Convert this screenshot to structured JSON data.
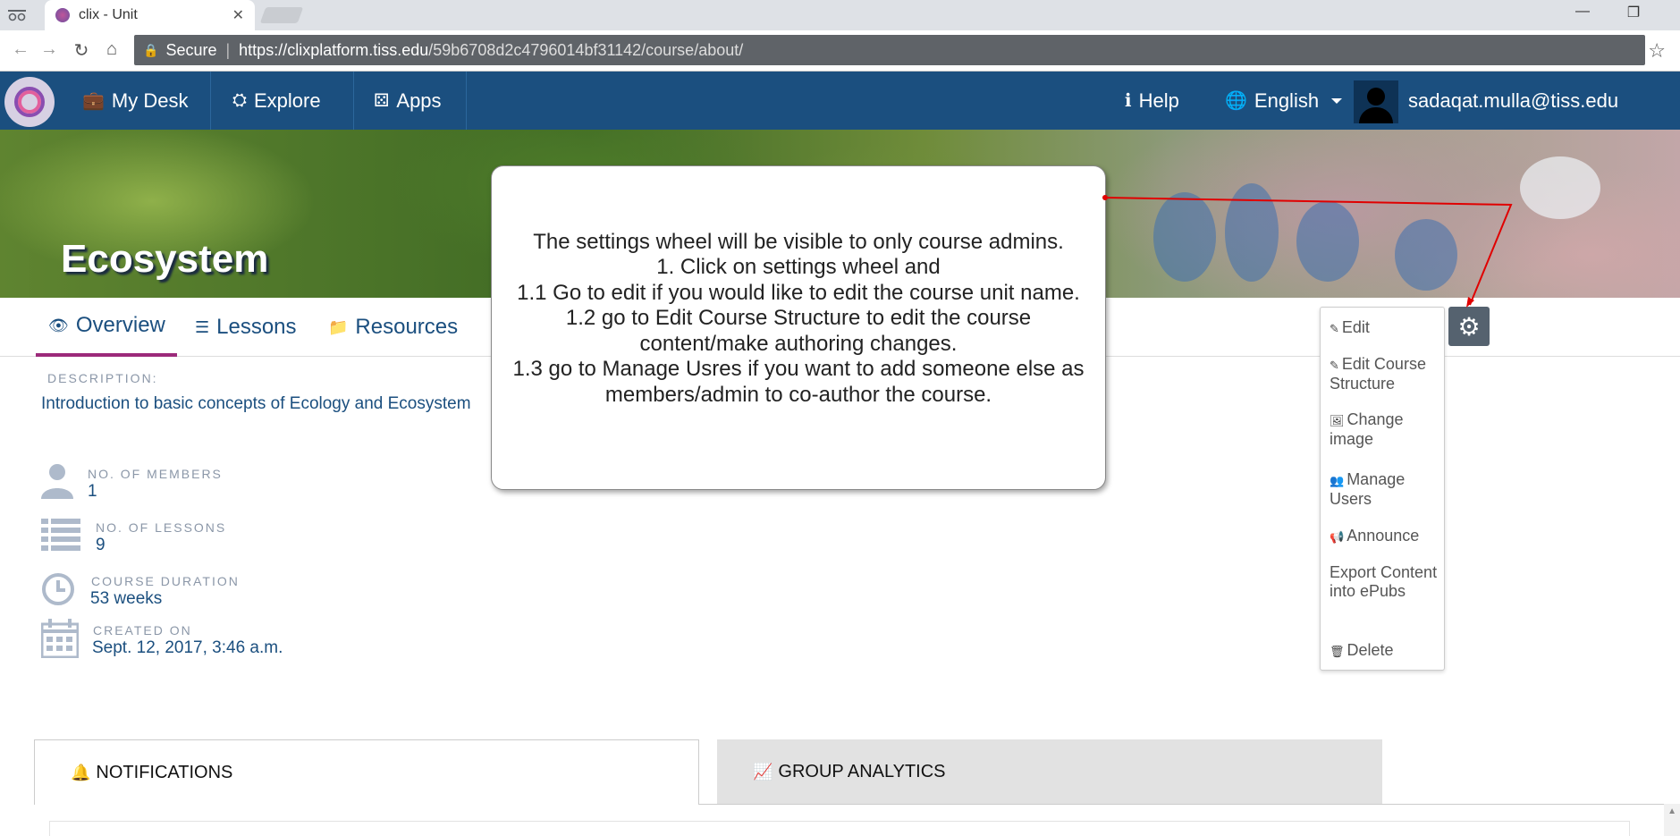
{
  "browser": {
    "tab_title": "clix - Unit",
    "tab_close": "✕",
    "security_label": "Secure",
    "url_host": "https://clixplatform.tiss.edu",
    "url_path": "/59b6708d2c4796014bf31142/course/about/",
    "minimize": "—",
    "restore": "❐"
  },
  "navbar": {
    "my_desk": "My Desk",
    "explore": "Explore",
    "apps": "Apps",
    "help": "Help",
    "language": "English",
    "user_email": "sadaqat.mulla@tiss.edu"
  },
  "course": {
    "title": "Ecosystem",
    "tabs": [
      {
        "label": "Overview"
      },
      {
        "label": "Lessons"
      },
      {
        "label": "Resources"
      }
    ],
    "description_label": "DESCRIPTION:",
    "description": "Introduction to basic concepts of Ecology and Ecosystem",
    "stats": {
      "members_label": "NO. OF MEMBERS",
      "members_value": "1",
      "lessons_label": "NO. OF LESSONS",
      "lessons_value": "9",
      "duration_label": "COURSE DURATION",
      "duration_value": "53 weeks",
      "created_label": "CREATED ON",
      "created_value": "Sept. 12, 2017, 3:46 a.m."
    }
  },
  "tooltip": {
    "lines": [
      "The settings wheel will be visible to only course admins.",
      "1. Click on settings wheel and",
      "1.1 Go to edit if you would like to edit the course unit name.",
      "1.2 go to Edit Course Structure to edit the course content/make authoring changes.",
      "1.3 go to Manage Usres if you want to add someone else as members/admin to co-author the course."
    ]
  },
  "settings_menu": {
    "items": [
      {
        "label": "Edit"
      },
      {
        "label": "Edit Course Structure"
      },
      {
        "label": "Change image"
      },
      {
        "label": "Manage Users"
      },
      {
        "label": "Announce"
      },
      {
        "label": "Export Content into ePubs"
      },
      {
        "label": "Delete"
      }
    ]
  },
  "panels": {
    "notifications": "NOTIFICATIONS",
    "analytics": "GROUP ANALYTICS"
  },
  "colors": {
    "navbar": "#1b4f7f",
    "accent": "#9c2a7a",
    "annotation_arrow": "#e00000"
  }
}
